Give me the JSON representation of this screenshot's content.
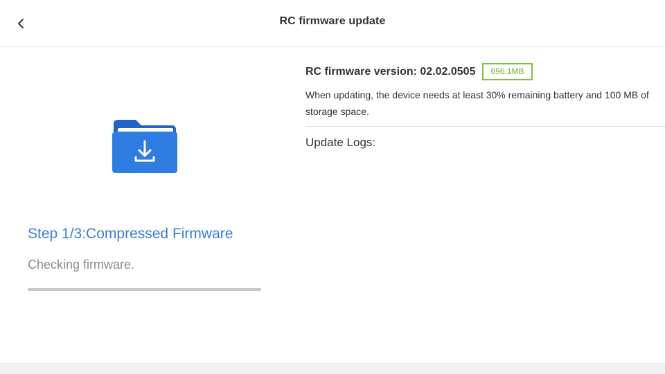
{
  "header": {
    "title": "RC firmware update",
    "back_icon": "chevron-left-icon"
  },
  "left": {
    "folder_icon": "folder-download-icon",
    "step_title": "Step 1/3:Compressed Firmware",
    "status": "Checking firmware.",
    "progress_percent": 0
  },
  "right": {
    "version_label": "RC firmware version: 02.02.0505",
    "size_badge": "696.1MB",
    "note": "When updating, the device needs at least 30% remaining battery and 100 MB of storage space.",
    "logs_label": "Update Logs:"
  },
  "colors": {
    "accent": "#3b7dd8",
    "badge_green": "#7bc043",
    "folder_blue": "#2f7de1"
  }
}
